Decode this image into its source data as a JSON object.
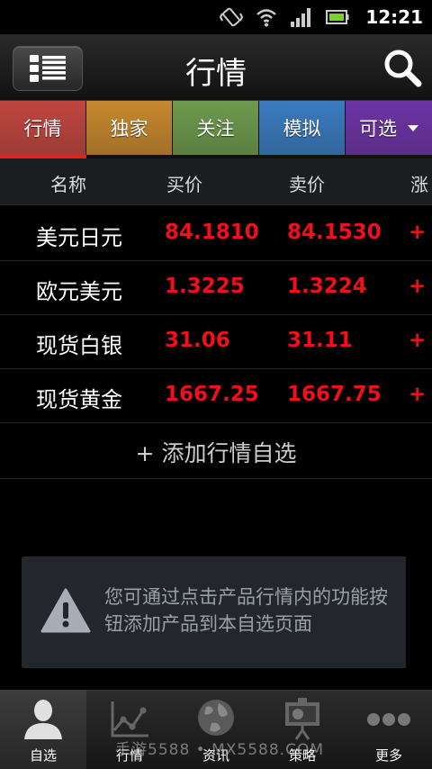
{
  "status_bar": {
    "time": "12:21"
  },
  "header": {
    "title": "行情"
  },
  "tabs": [
    {
      "label": "行情",
      "color": "#c0463f",
      "width": 95
    },
    {
      "label": "独家",
      "color": "#c6882e",
      "width": 95
    },
    {
      "label": "关注",
      "color": "#6e9a4e",
      "width": 95
    },
    {
      "label": "模拟",
      "color": "#3b7bbf",
      "width": 95
    },
    {
      "label": "可选",
      "color": "#6d34a6",
      "width": 96,
      "has_dropdown": true
    }
  ],
  "table": {
    "columns": [
      "名称",
      "买价",
      "卖价",
      "涨"
    ],
    "rows": [
      {
        "name": "美元日元",
        "buy": "84.1810",
        "sell": "84.1530",
        "chg": "+"
      },
      {
        "name": "欧元美元",
        "buy": "1.3225",
        "sell": "1.3224",
        "chg": "+"
      },
      {
        "name": "现货白银",
        "buy": "31.06",
        "sell": "31.11",
        "chg": "+"
      },
      {
        "name": "现货黄金",
        "buy": "1667.25",
        "sell": "1667.75",
        "chg": "+"
      }
    ],
    "add_label": "+ 添加行情自选"
  },
  "notice": {
    "text": "您可通过点击产品行情内的功能按钮添加产品到本自选页面"
  },
  "bottom_nav": [
    {
      "label": "自选",
      "icon": "person-icon"
    },
    {
      "label": "行情",
      "icon": "line-chart-icon"
    },
    {
      "label": "资讯",
      "icon": "globe-icon"
    },
    {
      "label": "策略",
      "icon": "presentation-board-icon"
    },
    {
      "label": "更多",
      "icon": "more-dots-icon"
    }
  ],
  "watermark": "手游5588 • MX5588.COM",
  "colors": {
    "price_red": "#f0101a",
    "active_underline": "#d7281e"
  }
}
